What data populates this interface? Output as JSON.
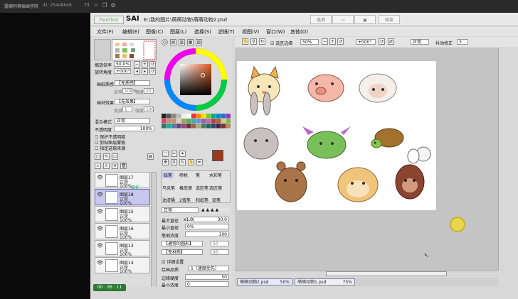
{
  "topbar": {
    "title": "露娜阿蒂插画学院",
    "id": "ID: 25448646",
    "count": "73"
  },
  "app": {
    "name": "SAI",
    "logo": "PaintTool",
    "path": "E:\\我的图片\\萌萌动物\\萌萌动物2.psd"
  },
  "window": {
    "btn1": "选消",
    "btn3": "结束"
  },
  "menu": [
    "文件(F)",
    "编辑(E)",
    "图像(C)",
    "图层(L)",
    "选择(S)",
    "滤镜(T)",
    "视图(V)",
    "窗口(W)",
    "其他(O)"
  ],
  "nav": {
    "zoom_label": "缩放倍率",
    "zoom": "50.0%",
    "angle_label": "旋转角度",
    "angle": "+000°"
  },
  "canvas_toolbar": {
    "check": "选区边缘",
    "zoom": "50%",
    "angle": "+000°",
    "mode": "正常",
    "stab_label": "抖动修正",
    "stab": "3"
  },
  "paper_texture": {
    "label": "画纸质感",
    "value": "【无质感】",
    "scale_label": "倍率",
    "scale": "100%",
    "strength_label": "强度",
    "strength": "20"
  },
  "paper_effect": {
    "label": "画材效果",
    "value": "【无效果】",
    "width_label": "宽度",
    "width": "1",
    "strength_label": "强度",
    "strength": "100"
  },
  "blend": {
    "label": "混合模式",
    "value": "正常",
    "opacity_label": "不透明度",
    "opacity": "100%"
  },
  "checks": [
    "保护不透明度",
    "剪贴图层蒙板",
    "指定选取来源"
  ],
  "layers": [
    {
      "name": "图层17",
      "mode": "正常",
      "op": "100%",
      "note": "保护"
    },
    {
      "name": "图层18",
      "mode": "正常",
      "op": "100%",
      "note": ""
    },
    {
      "name": "图层15",
      "mode": "正常",
      "op": "100%",
      "note": ""
    },
    {
      "name": "图层16",
      "mode": "正常",
      "op": "100%",
      "note": ""
    },
    {
      "name": "图层13",
      "mode": "正常",
      "op": "100%",
      "note": ""
    },
    {
      "name": "图层14",
      "mode": "正常",
      "op": "100%",
      "note": ""
    }
  ],
  "tools": [
    "铅笔",
    "喷枪",
    "笔",
    "水彩笔",
    "马克笔",
    "橡皮擦",
    "选区笔",
    "选区擦",
    "油漆桶",
    "2值笔",
    "和纸笔",
    "铅笔"
  ],
  "brush": {
    "mode": "正常",
    "max_label": "最大直径",
    "max_mult": "x1.0",
    "max": "30.0",
    "min_label": "最小直径",
    "min": "0%",
    "density_label": "笔刷浓度",
    "density": "100",
    "shape": "【通常的圆形】",
    "shape_val": "50",
    "texture": "【无材质】",
    "texture_val": "95",
    "detail": "详细设置",
    "quality_label": "绘画品质",
    "quality": "1（速度优先）",
    "hard_label": "边缘硬度",
    "hard": "50",
    "minden_label": "最小浓度",
    "minden": "0"
  },
  "tabs": [
    {
      "name": "萌萌动物2.psd",
      "zoom": "50%"
    },
    {
      "name": "萌萌动物1.psd",
      "zoom": "75%"
    }
  ],
  "bottom": {
    "rec": "00 : 06 : 11"
  },
  "colors": {
    "layer_selected": "#c7c8ee",
    "rec": "#2c7a33",
    "cursor": "#e8d44d"
  }
}
